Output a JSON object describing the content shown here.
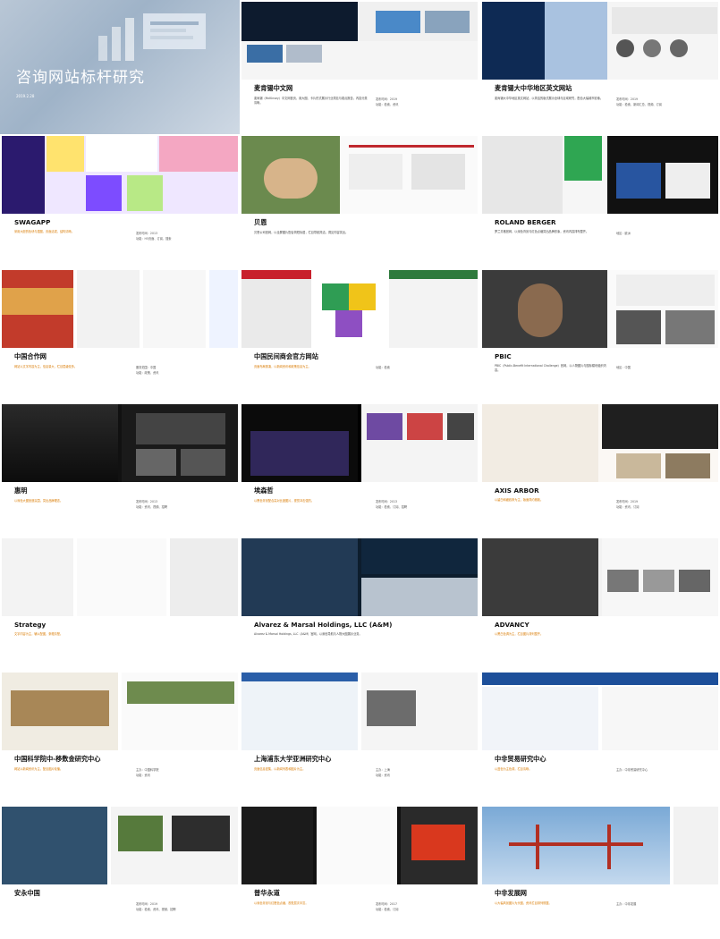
{
  "hero": {
    "title": "咨询网站标杆研究",
    "date": "2019.2.28"
  },
  "cards": [
    {
      "title": "麦肯锡中文网",
      "desc": "麦肯锡（McKinsey）中文网首页，用大图、卡片形式展示行业洞见与观点报告，内容分类清晰。",
      "highlight": "",
      "meta": [
        "发布时间：2019",
        "功能：检索、资讯"
      ]
    },
    {
      "title": "麦肯锡大中华地区英文网站",
      "desc": "麦肯锡大中华地区英文网站，以简洁的版式展示全球与区域研究，配合大幅城市影像。",
      "highlight": "",
      "meta": [
        "发布时间：2019",
        "功能：检索、新闻汇总、视频、订阅"
      ]
    },
    {
      "title": "SWAGAPP",
      "desc": "",
      "highlight": "采用大胆的色块与插图，页面活泼，结构清晰。",
      "meta": [
        "发布时间：2013",
        "功能：H5页面、订阅、搜索"
      ]
    },
    {
      "title": "贝恩",
      "desc": "贝恩公司官网，以全屏图片配合简短标语，栏目导航简洁，洞见内容突出。",
      "highlight": "",
      "meta": []
    },
    {
      "title": "ROLAND BERGER",
      "desc": "罗兰贝格官网，以深色背景与红色点缀突出品牌形象，资讯内容排布整齐。",
      "highlight": "",
      "meta": [
        "地区：欧洲"
      ]
    },
    {
      "title": "中国合作网",
      "desc": "",
      "highlight": "网站以文字内容为主，信息量大，栏目层级较多。",
      "meta": [
        "服务范围：中国",
        "功能：政策、资讯"
      ]
    },
    {
      "title": "中国民间商会官方网站",
      "desc": "",
      "highlight": "页面布局紧凑，以新闻资讯和政策信息为主。",
      "meta": [
        "功能：检索"
      ]
    },
    {
      "title": "PBIC",
      "desc": "PBIC（Public-Benefit International Challenge）官网，以人物图片与图标模块组织内容。",
      "highlight": "",
      "meta": [
        "地区：中国"
      ]
    },
    {
      "title": "惠明",
      "desc": "",
      "highlight": "以深色大图营造氛围，突出品牌理念。",
      "meta": [
        "发布时间：2013",
        "功能：资讯、视频、招聘"
      ]
    },
    {
      "title": "埃森哲",
      "desc": "",
      "highlight": "以黑色背景配合高对比度图片，视觉冲击强烈。",
      "meta": [
        "发布时间：2013",
        "功能：检索、订阅、招聘"
      ]
    },
    {
      "title": "AXIS ARBOR",
      "desc": "",
      "highlight": "以留白和细线条为主，版面简约雅致。",
      "meta": [
        "发布时间：2019",
        "功能：资讯、订阅"
      ]
    },
    {
      "title": "Strategy",
      "desc": "",
      "highlight": "文字内容为主，辅以配图，条理清楚。",
      "meta": []
    },
    {
      "title": "Alvarez & Marsal Holdings, LLC (A&M)",
      "desc": "Alvarez & Marsal Holdings, LLC（A&M）官网，以深色导航与人物大图展示业务。",
      "highlight": "",
      "meta": []
    },
    {
      "title": "ADVANCY",
      "desc": "",
      "highlight": "以黑白色调为主，栏目图片排列整齐。",
      "meta": []
    },
    {
      "title": "中国科学院中-移数金研究中心",
      "desc": "",
      "highlight": "网站以新闻资讯为主，配合图片轮播。",
      "meta": [
        "主办：中国科学院",
        "功能：资讯"
      ]
    },
    {
      "title": "上海浦东大学亚洲研究中心",
      "desc": "",
      "highlight": "页面信息密集，以新闻列表和图片为主。",
      "meta": [
        "主办：上海",
        "功能：资讯"
      ]
    },
    {
      "title": "中非贸易研究中心",
      "desc": "",
      "highlight": "以蓝色为主色调，栏目清晰。",
      "meta": [
        "主办：中非贸易研究中心"
      ]
    },
    {
      "title": "安永中国",
      "desc": "",
      "highlight": "",
      "meta": [
        "发布时间：2019",
        "功能：检索、资讯、视频、招聘"
      ]
    },
    {
      "title": "普华永道",
      "desc": "",
      "highlight": "以深色背景与红橙色点缀，视觉层次丰富。",
      "meta": [
        "发布时间：2017",
        "功能：检索、订阅"
      ]
    },
    {
      "title": "中非发展网",
      "desc": "",
      "highlight": "以大幅风景图片为头图，资讯栏目排列规整。",
      "meta": [
        "主办：中非发展"
      ]
    }
  ],
  "colors": {
    "accent": "#d97a00",
    "hero": "#9fb3c8"
  }
}
